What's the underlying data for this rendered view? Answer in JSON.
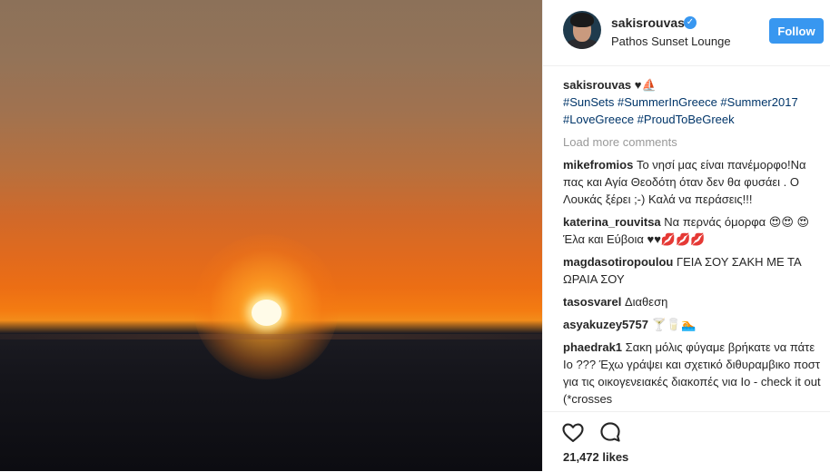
{
  "post": {
    "username": "sakisrouvas",
    "location": "Pathos Sunset Lounge",
    "follow_label": "Follow",
    "caption_emoji": "♥⛵",
    "caption_tags_line1": "#SunSets #SummerInGreece #Summer2017",
    "caption_tags_line2": "#LoveGreece #ProudToBeGreek",
    "load_more": "Load more comments",
    "likes": "21,472 likes"
  },
  "comments": [
    {
      "user": "mikefromios",
      "text": "Το νησί μας είναι πανέμορφο!Να πας και Αγία Θεοδότη όταν δεν θα φυσάει . Ο Λουκάς ξέρει ;-) Καλά να περάσεις!!!"
    },
    {
      "user": "katerina_rouvitsa",
      "text": "Να περνάς όμορφα 😍😍 😍 Έλα και Εύβοια ♥♥💋💋💋"
    },
    {
      "user": "magdasotiropoulou",
      "text": "ΓΕΙΑ ΣΟΥ ΣΑΚΗ ΜΕ ΤΑ ΩΡΑΙΑ ΣΟΥ"
    },
    {
      "user": "tasosvarel",
      "text": "Διαθεση"
    },
    {
      "user": "asyakuzey5757",
      "text": "🍸🥛🏊"
    },
    {
      "user": "phaedrak1",
      "text": "Σακη μόλις φύγαμε βρήκατε να πάτε Ιο ??? Έχω γράψει και σχετικό διθυραμβικο ποστ για τις οικογενειακές διακοπές νια Ιο - check it out (*crosses"
    }
  ],
  "colors": {
    "accent": "#3897f0",
    "hashtag": "#003569",
    "muted": "#999999"
  },
  "icons": {
    "like": "heart-outline-icon",
    "comment": "speech-bubble-icon",
    "verified": "verified-badge-icon"
  }
}
